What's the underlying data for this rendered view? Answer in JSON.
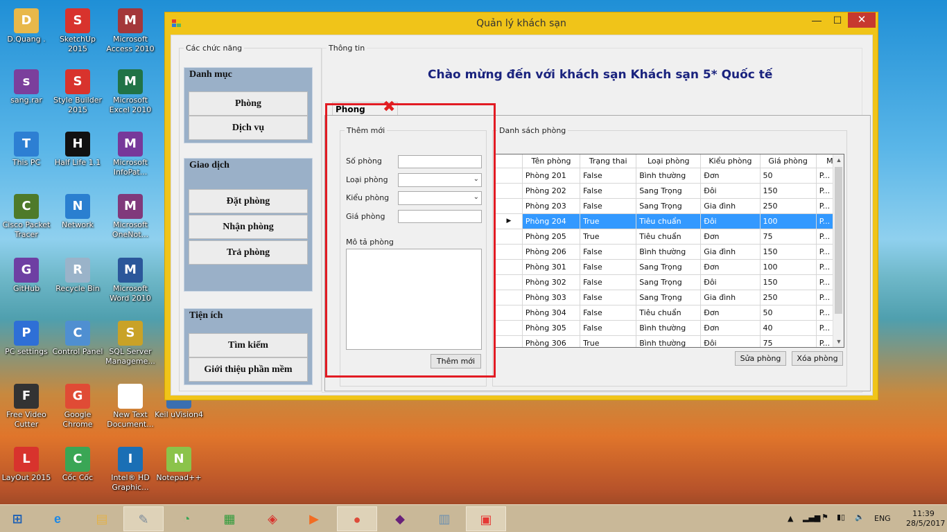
{
  "desktop": {
    "icons": [
      {
        "label": "D.Quang .",
        "icon": "folder-icon",
        "color": "#e8b84a"
      },
      {
        "label": "SketchUp 2015",
        "icon": "sketchup-icon",
        "color": "#d8332d"
      },
      {
        "label": "Microsoft Access 2010",
        "icon": "access-icon",
        "color": "#a4373a"
      },
      {
        "label": "sang.rar",
        "icon": "winrar-icon",
        "color": "#7b3f9c"
      },
      {
        "label": "Style Builder 2015",
        "icon": "stylebuilder-icon",
        "color": "#d8332d"
      },
      {
        "label": "Microsoft Excel 2010",
        "icon": "excel-icon",
        "color": "#217346"
      },
      {
        "label": "This PC",
        "icon": "computer-icon",
        "color": "#2d7fd3"
      },
      {
        "label": "Half Life 1.1",
        "icon": "halflife-icon",
        "color": "#111111"
      },
      {
        "label": "Microsoft InfoPat...",
        "icon": "infopath-icon",
        "color": "#77389a"
      },
      {
        "label": "Cisco Packet Tracer",
        "icon": "cisco-icon",
        "color": "#4e7a2a"
      },
      {
        "label": "Network",
        "icon": "network-icon",
        "color": "#2a7fd0"
      },
      {
        "label": "Microsoft OneNot...",
        "icon": "onenote-icon",
        "color": "#80397b"
      },
      {
        "label": "GitHub",
        "icon": "github-icon",
        "color": "#6e3fa3"
      },
      {
        "label": "Recycle Bin",
        "icon": "recycle-bin-icon",
        "color": "#9ab3c9"
      },
      {
        "label": "Microsoft Word 2010",
        "icon": "word-icon",
        "color": "#2b579a"
      },
      {
        "label": "PC settings",
        "icon": "gear-icon",
        "color": "#2e6fd6"
      },
      {
        "label": "Control Panel",
        "icon": "control-panel-icon",
        "color": "#4f8fd1"
      },
      {
        "label": "SQL Server Manageme...",
        "icon": "sql-server-icon",
        "color": "#c9a227"
      },
      {
        "label": "Free Video Cutter",
        "icon": "video-cutter-icon",
        "color": "#333333"
      },
      {
        "label": "Google Chrome",
        "icon": "chrome-icon",
        "color": "#e04b35"
      },
      {
        "label": "New Text Document...",
        "icon": "text-document-icon",
        "color": "#ffffff"
      },
      {
        "label": "Keil uVision4",
        "icon": "keil-icon",
        "color": "#3a6fb0"
      },
      {
        "label": "LayOut 2015",
        "icon": "layout-icon",
        "color": "#d8332d"
      },
      {
        "label": "Cốc Cốc",
        "icon": "coccoc-icon",
        "color": "#3aa655"
      },
      {
        "label": "Intel® HD Graphic...",
        "icon": "intel-icon",
        "color": "#1a6fb5"
      },
      {
        "label": "Notepad++",
        "icon": "notepadpp-icon",
        "color": "#8bc34a"
      }
    ]
  },
  "window": {
    "title": "Quản lý khách sạn",
    "controls": {
      "minimize": "—",
      "maximize": "☐",
      "close": "✕"
    }
  },
  "left": {
    "legend": "Các chức năng",
    "danh_muc": {
      "title": "Danh mục",
      "buttons": [
        "Phòng",
        "Dịch vụ"
      ]
    },
    "giao_dich": {
      "title": "Giao dịch",
      "buttons": [
        "Đặt phòng",
        "Nhận phòng",
        "Trả phòng"
      ]
    },
    "tien_ich": {
      "title": "Tiện ích",
      "buttons": [
        "Tìm kiếm",
        "Giới thiệu phần mềm"
      ]
    }
  },
  "info": {
    "legend": "Thông tin",
    "welcome": "Chào mừng đến với khách sạn Khách sạn 5* Quốc tế",
    "tab_label": "Phong"
  },
  "add_form": {
    "legend": "Thêm mới",
    "so_phong_label": "Số phòng",
    "loai_phong_label": "Loại phòng",
    "kieu_phong_label": "Kiểu phòng",
    "gia_phong_label": "Giá phòng",
    "mo_ta_label": "Mô tả phòng",
    "submit": "Thêm mới"
  },
  "list": {
    "legend": "Danh sách phòng",
    "columns": [
      "Tên phòng",
      "Trạng thai",
      "Loại phòng",
      "Kiểu phòng",
      "Giá phòng",
      "M"
    ],
    "rows": [
      [
        "Phòng 201",
        "False",
        "Bình thường",
        "Đơn",
        "50",
        "P..."
      ],
      [
        "Phòng 202",
        "False",
        "Sang Trọng",
        "Đôi",
        "150",
        "P..."
      ],
      [
        "Phòng 203",
        "False",
        "Sang Trọng",
        "Gia đình",
        "250",
        "P..."
      ],
      [
        "Phòng 204",
        "True",
        "Tiêu chuẩn",
        "Đôi",
        "100",
        "P..."
      ],
      [
        "Phòng 205",
        "True",
        "Tiêu chuẩn",
        "Đơn",
        "75",
        "P..."
      ],
      [
        "Phòng 206",
        "False",
        "Bình thường",
        "Gia đình",
        "150",
        "P..."
      ],
      [
        "Phòng 301",
        "False",
        "Sang Trọng",
        "Đơn",
        "100",
        "P..."
      ],
      [
        "Phòng 302",
        "False",
        "Sang Trọng",
        "Đôi",
        "150",
        "P..."
      ],
      [
        "Phòng 303",
        "False",
        "Sang Trọng",
        "Gia đình",
        "250",
        "P..."
      ],
      [
        "Phòng 304",
        "False",
        "Tiêu chuẩn",
        "Đơn",
        "50",
        "P..."
      ],
      [
        "Phòng 305",
        "False",
        "Bình thường",
        "Đơn",
        "40",
        "P..."
      ],
      [
        "Phòng 306",
        "True",
        "Bình thường",
        "Đôi",
        "75",
        "P..."
      ]
    ],
    "selected_row": 3,
    "edit_button": "Sửa phòng",
    "delete_button": "Xóa phòng"
  },
  "taskbar": {
    "items": [
      {
        "icon": "start-icon"
      },
      {
        "icon": "internet-explorer-icon"
      },
      {
        "icon": "file-explorer-icon"
      },
      {
        "icon": "paint-icon"
      },
      {
        "icon": "coccoc-icon"
      },
      {
        "icon": "store-icon"
      },
      {
        "icon": "sketchup-icon"
      },
      {
        "icon": "media-player-icon"
      },
      {
        "icon": "chrome-icon"
      },
      {
        "icon": "visual-studio-icon"
      },
      {
        "icon": "task-manager-icon"
      },
      {
        "icon": "hotel-app-icon"
      }
    ],
    "language": "ENG",
    "time": "11:39",
    "date": "28/5/2017"
  }
}
